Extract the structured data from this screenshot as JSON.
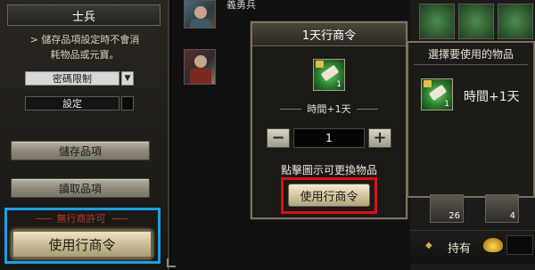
{
  "left_panel": {
    "title": "士兵",
    "note_line1": "> 儲存品項設定時不會消",
    "note_line2": "耗物品或元寶。",
    "password_select": "密碼限制",
    "password_arrow": "▼",
    "settings_label": "設定",
    "store_button": "儲存品項",
    "read_button": "讀取品項",
    "no_permit_text": "無行商許可",
    "use_button": "使用行商令"
  },
  "center": {
    "unit_name": "義勇兵"
  },
  "popup": {
    "title": "1天行商令",
    "item_count": "1",
    "item_name": "時間+1天",
    "quantity": "1",
    "minus_label": "−",
    "plus_label": "+",
    "hint": "點擊圖示可更換物品",
    "use_button": "使用行商令"
  },
  "right_popup": {
    "title": "選擇要使用的物品",
    "option_count": "1",
    "option_label": "時間+1天"
  },
  "right_panel": {
    "slot_counts": [
      "26",
      "4"
    ],
    "own_label": "持有",
    "star": "◆"
  },
  "colors": {
    "highlight_blue": "#1c9ee3",
    "highlight_red": "#d9101a",
    "warning_red": "#c0392b"
  },
  "icons": {
    "item": "scroll-icon",
    "lock": "lock-icon",
    "currency": "gold-ingot-icon"
  }
}
